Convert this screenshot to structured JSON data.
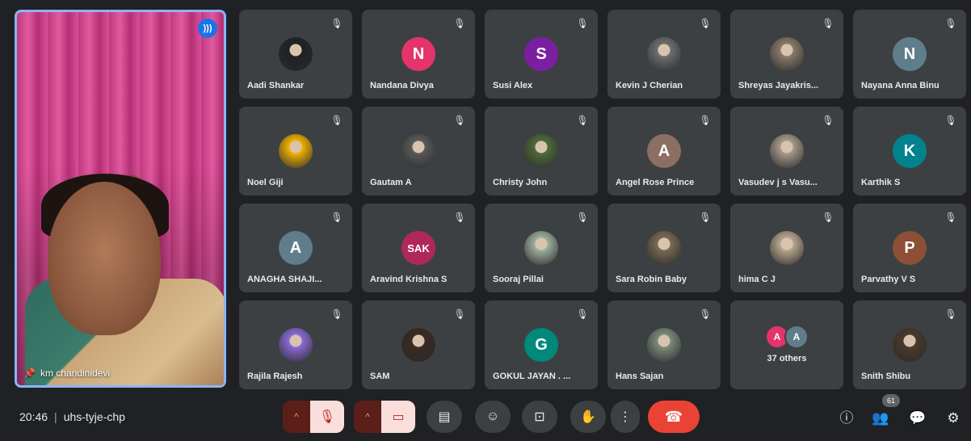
{
  "featured": {
    "name": "km chandinidevi",
    "speaking_icon": "speaker-waves-icon",
    "pin_icon": "pin-icon"
  },
  "participants": [
    {
      "name": "Aadi Shankar",
      "initial": "",
      "color": "#202124",
      "photo": true
    },
    {
      "name": "Nandana Divya",
      "initial": "N",
      "color": "#e5336c"
    },
    {
      "name": "Susi Alex",
      "initial": "S",
      "color": "#7b1fa2"
    },
    {
      "name": "Kevin J Cherian",
      "initial": "",
      "color": "#6f6f6f",
      "photo": true
    },
    {
      "name": "Shreyas Jayakris...",
      "initial": "",
      "color": "#8a7b6a",
      "photo": true
    },
    {
      "name": "Nayana Anna Binu",
      "initial": "N",
      "color": "#607d8b"
    },
    {
      "name": "Noel Giji",
      "initial": "",
      "color": "#f5b400",
      "photo": true
    },
    {
      "name": "Gautam A",
      "initial": "",
      "color": "#5a5a5a",
      "photo": true
    },
    {
      "name": "Christy John",
      "initial": "",
      "color": "#4e6b3a",
      "photo": true
    },
    {
      "name": "Angel Rose Prince",
      "initial": "A",
      "color": "#8d6e63"
    },
    {
      "name": "Vasudev j s Vasu...",
      "initial": "",
      "color": "#a89b8c",
      "photo": true
    },
    {
      "name": "Karthik S",
      "initial": "K",
      "color": "#00838f"
    },
    {
      "name": "ANAGHA SHAJI...",
      "initial": "A",
      "color": "#607d8b"
    },
    {
      "name": "Aravind Krishna S",
      "initial": "SAK",
      "color": "#b0285a",
      "small": true
    },
    {
      "name": "Sooraj Pillai",
      "initial": "",
      "color": "#9fb0a0",
      "photo": true
    },
    {
      "name": "Sara Robin Baby",
      "initial": "",
      "color": "#7a6a55",
      "photo": true
    },
    {
      "name": "hima C J",
      "initial": "",
      "color": "#b9a88f",
      "photo": true
    },
    {
      "name": "Parvathy V S",
      "initial": "P",
      "color": "#8d4f35"
    },
    {
      "name": "Rajila Rajesh",
      "initial": "",
      "color": "#8c6bd6",
      "photo": true
    },
    {
      "name": "SAM",
      "initial": "",
      "color": "#3a2a22",
      "photo": true
    },
    {
      "name": "GOKUL JAYAN . ...",
      "initial": "G",
      "color": "#00897b"
    },
    {
      "name": "Hans Sajan",
      "initial": "",
      "color": "#7d8b7a",
      "photo": true
    },
    {
      "name": "37 others",
      "others": true,
      "minis": [
        {
          "initial": "A",
          "color": "#e5336c"
        },
        {
          "initial": "A",
          "color": "#607d8b"
        }
      ]
    },
    {
      "name": "Snith Shibu",
      "initial": "",
      "color": "#4a3a2c",
      "photo": true
    }
  ],
  "meeting": {
    "time": "20:46",
    "separator": "|",
    "code": "uhs-tyje-chp"
  },
  "controls": {
    "mic_icon": "mic-off-icon",
    "camera_icon": "camera-off-icon",
    "captions_icon": "captions-icon",
    "emoji_icon": "emoji-icon",
    "present_icon": "present-screen-icon",
    "hand_icon": "raise-hand-icon",
    "more_icon": "more-vertical-icon",
    "end_icon": "end-call-icon"
  },
  "right_panel": {
    "participant_count": "61",
    "info_icon": "info-icon",
    "people_icon": "people-icon",
    "chat_icon": "chat-icon",
    "activities_icon": "activities-icon"
  }
}
